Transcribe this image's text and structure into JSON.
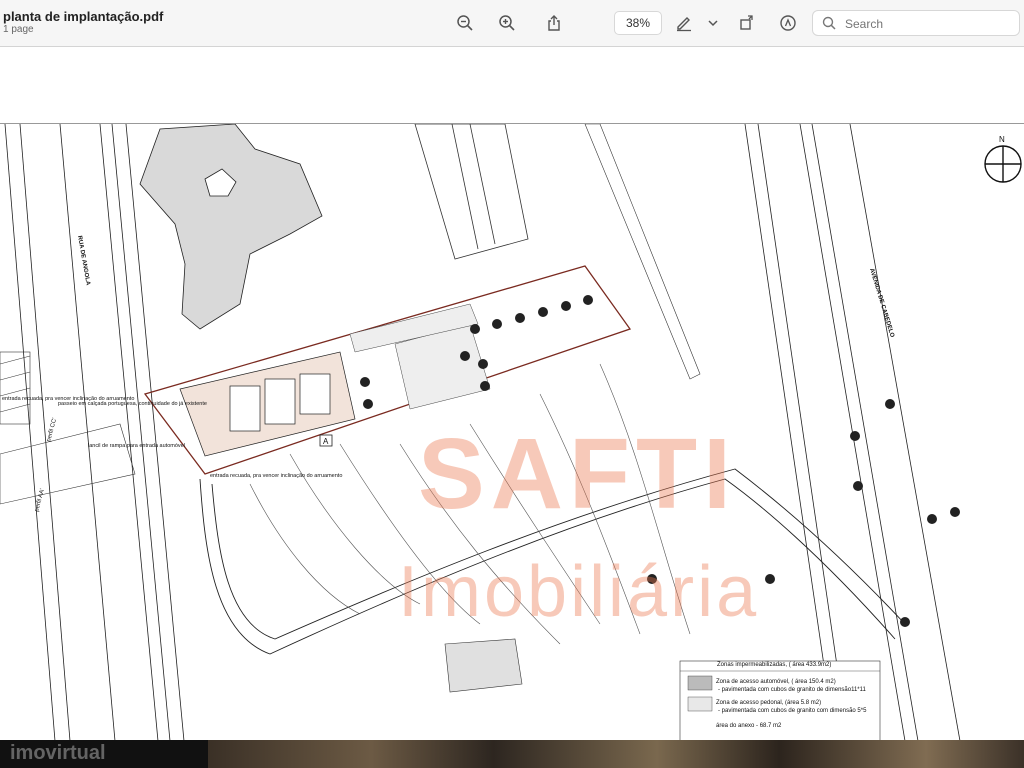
{
  "document": {
    "title": "planta de implantação.pdf",
    "subtitle": "1 page"
  },
  "toolbar": {
    "zoom": "38%",
    "search_placeholder": "Search"
  },
  "plan": {
    "street_left": "RUA DE ANGOLA",
    "street_right": "AVENIDA DE CABEDELO",
    "north": "N",
    "building_label": "A",
    "note_1": "entrada recuada, pra vencer inclinação do arruamento",
    "note_2": "passeio em calçada portuguesa, continuidade do já existente",
    "note_3": "lancil de rampa para entrada automóvel",
    "note_4": "entrada recuada, pra vencer inclinação do arruamento",
    "section_cc": "perfil CC'",
    "section_aa": "perfil AA'",
    "legend": {
      "item_1": "Zonas impermeabilizadas, ( área 433.9m2)",
      "item_2a": "Zona de acesso automóvel, ( área 150.4 m2)",
      "item_2b": "- pavimentada com cubos de granito de dimensão11*11",
      "item_3a": "Zona de acesso pedonal, (área 5.8 m2)",
      "item_3b": "- pavimentada com cubos de granito com dimensão 5*5",
      "item_4": "área do anexo - 68.7 m2"
    }
  },
  "watermark": {
    "line1": "SAFTI",
    "line2": "Imobiliária",
    "bottom_logo": "imovirtual"
  },
  "colors": {
    "watermark": "#eb7850",
    "toolbar_bg": "#f6f6f6"
  }
}
